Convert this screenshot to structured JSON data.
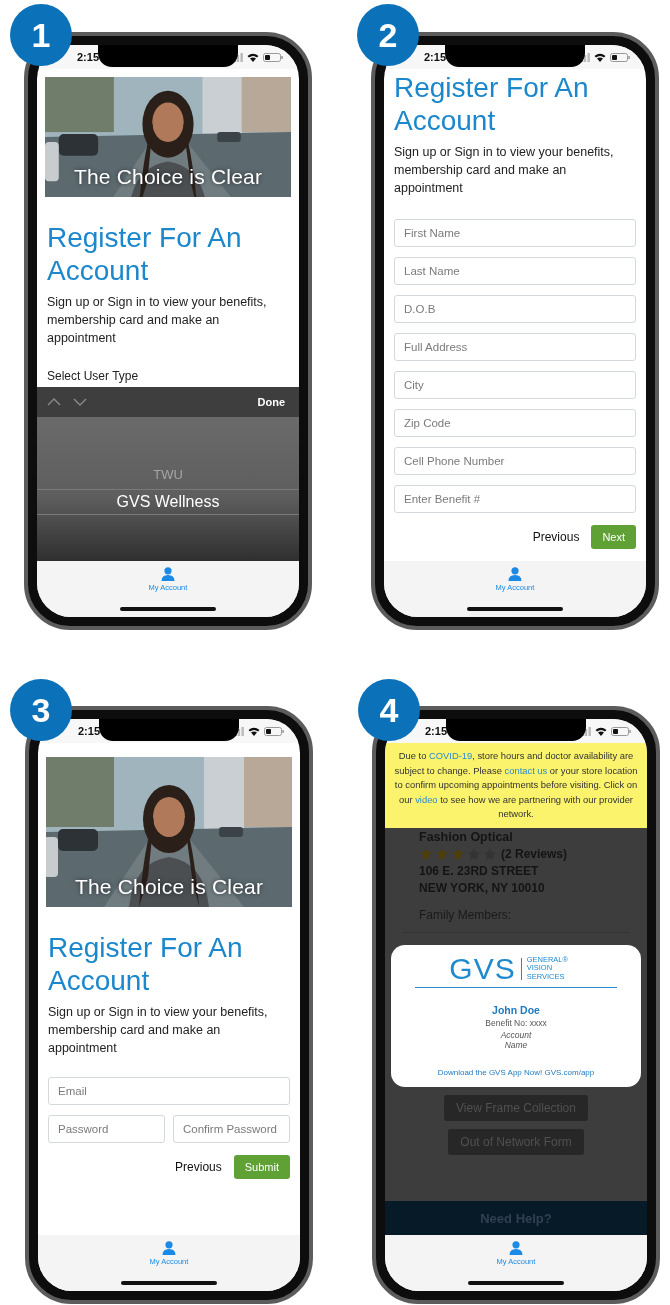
{
  "phones": [
    {
      "step": "1",
      "kind": "picker",
      "time": "2:15",
      "hero": {
        "kind": "picture",
        "caption": "The Choice is Clear"
      },
      "title": "Register For An Account",
      "subtitle": "Sign up or Sign in to view your benefits, membership card and make an appointment",
      "select_label": "Select User Type",
      "picker": {
        "done": "Done",
        "options": [
          {
            "label": "TWU",
            "selected": false
          },
          {
            "label": "GVS Wellness",
            "selected": true
          }
        ]
      },
      "tab": {
        "label": "My Account",
        "selected": true
      }
    },
    {
      "step": "2",
      "kind": "form",
      "time": "2:15",
      "title": "Register For An Account",
      "subtitle": "Sign up or Sign in to view your benefits, membership card and make an appointment",
      "field_rows": [
        [
          {
            "placeholder": "First Name"
          }
        ],
        [
          {
            "placeholder": "Last Name"
          }
        ],
        [
          {
            "placeholder": "D.O.B"
          }
        ],
        [
          {
            "placeholder": "Full Address"
          }
        ],
        [
          {
            "placeholder": "City"
          }
        ],
        [
          {
            "placeholder": "Zip Code"
          }
        ],
        [
          {
            "placeholder": "Cell Phone Number"
          }
        ],
        [
          {
            "placeholder": "Enter Benefit #"
          }
        ]
      ],
      "actions": [
        {
          "label": "Previous",
          "kind": "link"
        },
        {
          "label": "Next",
          "kind": "primary"
        }
      ],
      "tab": {
        "label": "My Account",
        "selected": true
      }
    },
    {
      "step": "3",
      "kind": "form",
      "time": "2:15",
      "hero": {
        "kind": "picture",
        "caption": "The Choice is Clear"
      },
      "title": "Register For An Account",
      "subtitle": "Sign up or Sign in to view your benefits, membership card and make an appointment",
      "field_rows": [
        [
          {
            "placeholder": "Email"
          }
        ],
        [
          {
            "placeholder": "Password"
          },
          {
            "placeholder": "Confirm Password"
          }
        ]
      ],
      "actions": [
        {
          "label": "Previous",
          "kind": "link"
        },
        {
          "label": "Submit",
          "kind": "primary"
        }
      ],
      "tab": {
        "label": "My Account",
        "selected": true
      }
    },
    {
      "step": "4",
      "kind": "card",
      "time": "2:15",
      "notice": [
        {
          "text": "Due to ",
          "link": false
        },
        {
          "text": "COVID-19",
          "link": true
        },
        {
          "text": ", store hours and doctor availability are subject to change. Please ",
          "link": false
        },
        {
          "text": "contact us",
          "link": true
        },
        {
          "text": " or your store location to confirm upcoming appointments before visiting. Click on our ",
          "link": false
        },
        {
          "text": "video",
          "link": true
        },
        {
          "text": " to see how we are partnering with our provider network.",
          "link": false
        }
      ],
      "store": {
        "name": "Fashion Optical",
        "stars": 3,
        "reviews": "(2 Reviews)",
        "address_lines": [
          "106 E. 23RD STREET",
          "NEW YORK, NY 10010"
        ]
      },
      "family_label": "Family Members:",
      "member_card": {
        "logo": "GVS",
        "logo_name": "GENERAL® VISION SERVICES",
        "name": "John Doe",
        "benefit": "Benefit No: xxxx",
        "account": "Account Name",
        "download": "Download the GVS App Now! GVS.com/app"
      },
      "buttons": [
        "View Frame Collection",
        "Out of Network Form"
      ],
      "help": "Need Help?",
      "tab": {
        "label": "My Account",
        "selected": true
      }
    }
  ]
}
